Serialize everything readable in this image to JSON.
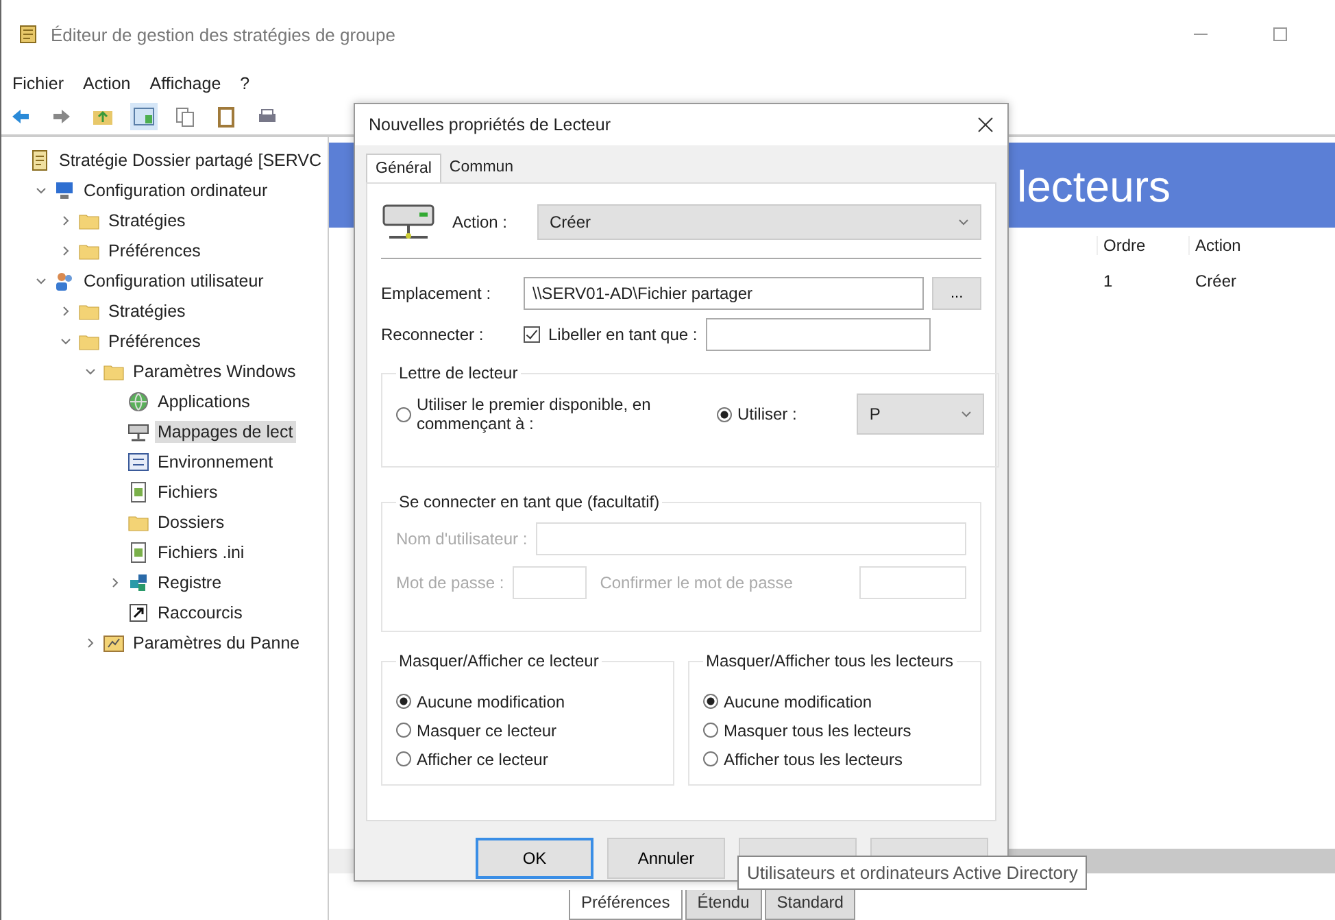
{
  "window": {
    "title": "Éditeur de gestion des stratégies de groupe"
  },
  "menu": [
    "Fichier",
    "Action",
    "Affichage",
    "?"
  ],
  "tree": [
    {
      "label": "Stratégie Dossier partagé [SERVC",
      "kind": "policy",
      "selected": false,
      "children": [
        {
          "label": "Configuration ordinateur",
          "kind": "computer",
          "expanded": true,
          "selected": false,
          "children": [
            {
              "label": "Stratégies",
              "kind": "folder",
              "expanded": false,
              "selected": false
            },
            {
              "label": "Préférences",
              "kind": "folder",
              "expanded": false,
              "selected": false
            }
          ]
        },
        {
          "label": "Configuration utilisateur",
          "kind": "users",
          "expanded": true,
          "selected": false,
          "children": [
            {
              "label": "Stratégies",
              "kind": "folder",
              "expanded": false,
              "selected": false
            },
            {
              "label": "Préférences",
              "kind": "folder",
              "expanded": true,
              "selected": false,
              "children": [
                {
                  "label": "Paramètres Windows",
                  "kind": "folder",
                  "expanded": true,
                  "selected": false,
                  "children": [
                    {
                      "label": "Applications",
                      "kind": "globe",
                      "selected": false
                    },
                    {
                      "label": "Mappages de lect",
                      "kind": "drive",
                      "selected": true
                    },
                    {
                      "label": "Environnement",
                      "kind": "env",
                      "selected": false
                    },
                    {
                      "label": "Fichiers",
                      "kind": "files",
                      "selected": false
                    },
                    {
                      "label": "Dossiers",
                      "kind": "folder",
                      "selected": false
                    },
                    {
                      "label": "Fichiers .ini",
                      "kind": "ini",
                      "selected": false
                    },
                    {
                      "label": "Registre",
                      "kind": "registry",
                      "expanded": false,
                      "selected": false
                    },
                    {
                      "label": "Raccourcis",
                      "kind": "shortcut",
                      "selected": false
                    }
                  ]
                },
                {
                  "label": "Paramètres du Panne",
                  "kind": "panel",
                  "expanded": false,
                  "selected": false
                }
              ]
            }
          ]
        }
      ]
    }
  ],
  "content": {
    "header": "lecteurs",
    "columns": [
      "Ordre",
      "Action"
    ],
    "rows": [
      [
        "1",
        "Créer"
      ]
    ]
  },
  "bottom_tabs": [
    {
      "label": "Préférences",
      "selected": true
    },
    {
      "label": "Étendu",
      "selected": false
    },
    {
      "label": "Standard",
      "selected": false
    }
  ],
  "dialog": {
    "title": "Nouvelles propriétés de Lecteur",
    "tabs": [
      {
        "label": "Général",
        "selected": true
      },
      {
        "label": "Commun",
        "selected": false
      }
    ],
    "action": {
      "label": "Action :",
      "value": "Créer"
    },
    "location": {
      "label": "Emplacement :",
      "value": "\\\\SERV01-AD\\Fichier partager",
      "browse": "..."
    },
    "reconnect": {
      "label": "Reconnecter :",
      "checkbox_label": "Libeller en tant que :",
      "checked": true
    },
    "drive_letter": {
      "title": "Lettre de lecteur",
      "options": [
        {
          "label": "Utiliser le premier disponible, en commençant à :",
          "selected": false
        },
        {
          "label": "Utiliser :",
          "selected": true
        }
      ],
      "letter": "P"
    },
    "connect_as": {
      "title": "Se connecter en tant que (facultatif)",
      "disabled": true,
      "username": "Nom d'utilisateur :",
      "password": "Mot de passe :",
      "confirm": "Confirmer le mot de passe"
    },
    "hide_groups": [
      {
        "title": "Masquer/Afficher ce lecteur",
        "options": [
          {
            "label": "Aucune modification",
            "selected": true
          },
          {
            "label": "Masquer ce lecteur",
            "selected": false
          },
          {
            "label": "Afficher ce lecteur",
            "selected": false
          }
        ]
      },
      {
        "title": "Masquer/Afficher tous les lecteurs",
        "options": [
          {
            "label": "Aucune modification",
            "selected": true
          },
          {
            "label": "Masquer tous les lecteurs",
            "selected": false
          },
          {
            "label": "Afficher tous les lecteurs",
            "selected": false
          }
        ]
      }
    ],
    "buttons": [
      "OK",
      "Annuler"
    ]
  },
  "tooltip": "Utilisateurs et ordinateurs Active Directory"
}
